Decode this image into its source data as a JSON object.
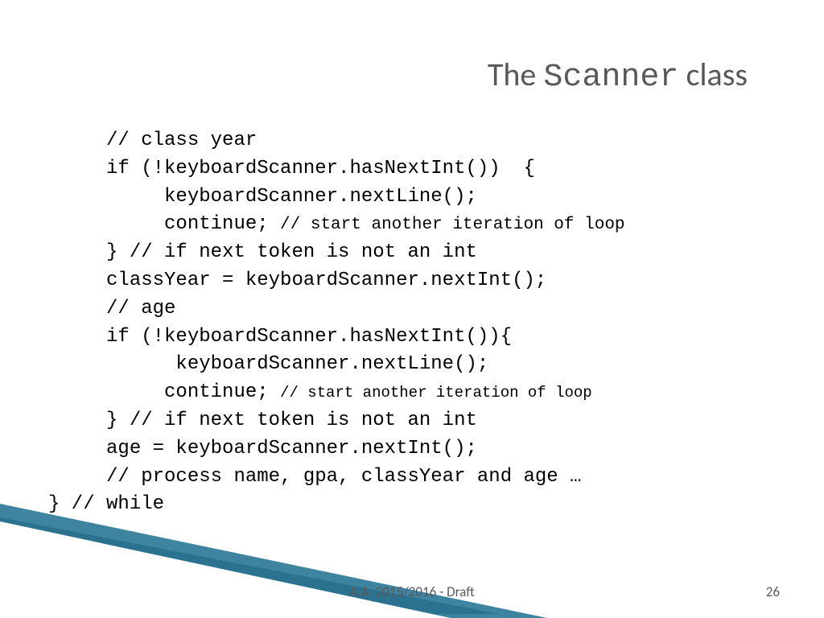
{
  "title": {
    "pre": "The ",
    "mono": "Scanner",
    "post": " class"
  },
  "code": {
    "l01": "     // class year",
    "l02": "     if (!keyboardScanner.hasNextInt())  {",
    "l03": "          keyboardScanner.nextLine();",
    "l04a": "          continue; ",
    "l04b": "// start another iteration of loop",
    "l05": "     } // if next token is not an int",
    "l06": "     classYear = keyboardScanner.nextInt();",
    "l07": "     // age",
    "l08": "     if (!keyboardScanner.hasNextInt()){",
    "l09": "           keyboardScanner.nextLine();",
    "l10a": "          continue; ",
    "l10b": "// start another iteration of loop",
    "l11": "     } // if next token is not an int",
    "l12": "     age = keyboardScanner.nextInt();",
    "l13": "     // process name, gpa, classYear and age …",
    "l14": "} // while"
  },
  "footer": "A.A. 2015/2016  -  Draft",
  "page": "26"
}
